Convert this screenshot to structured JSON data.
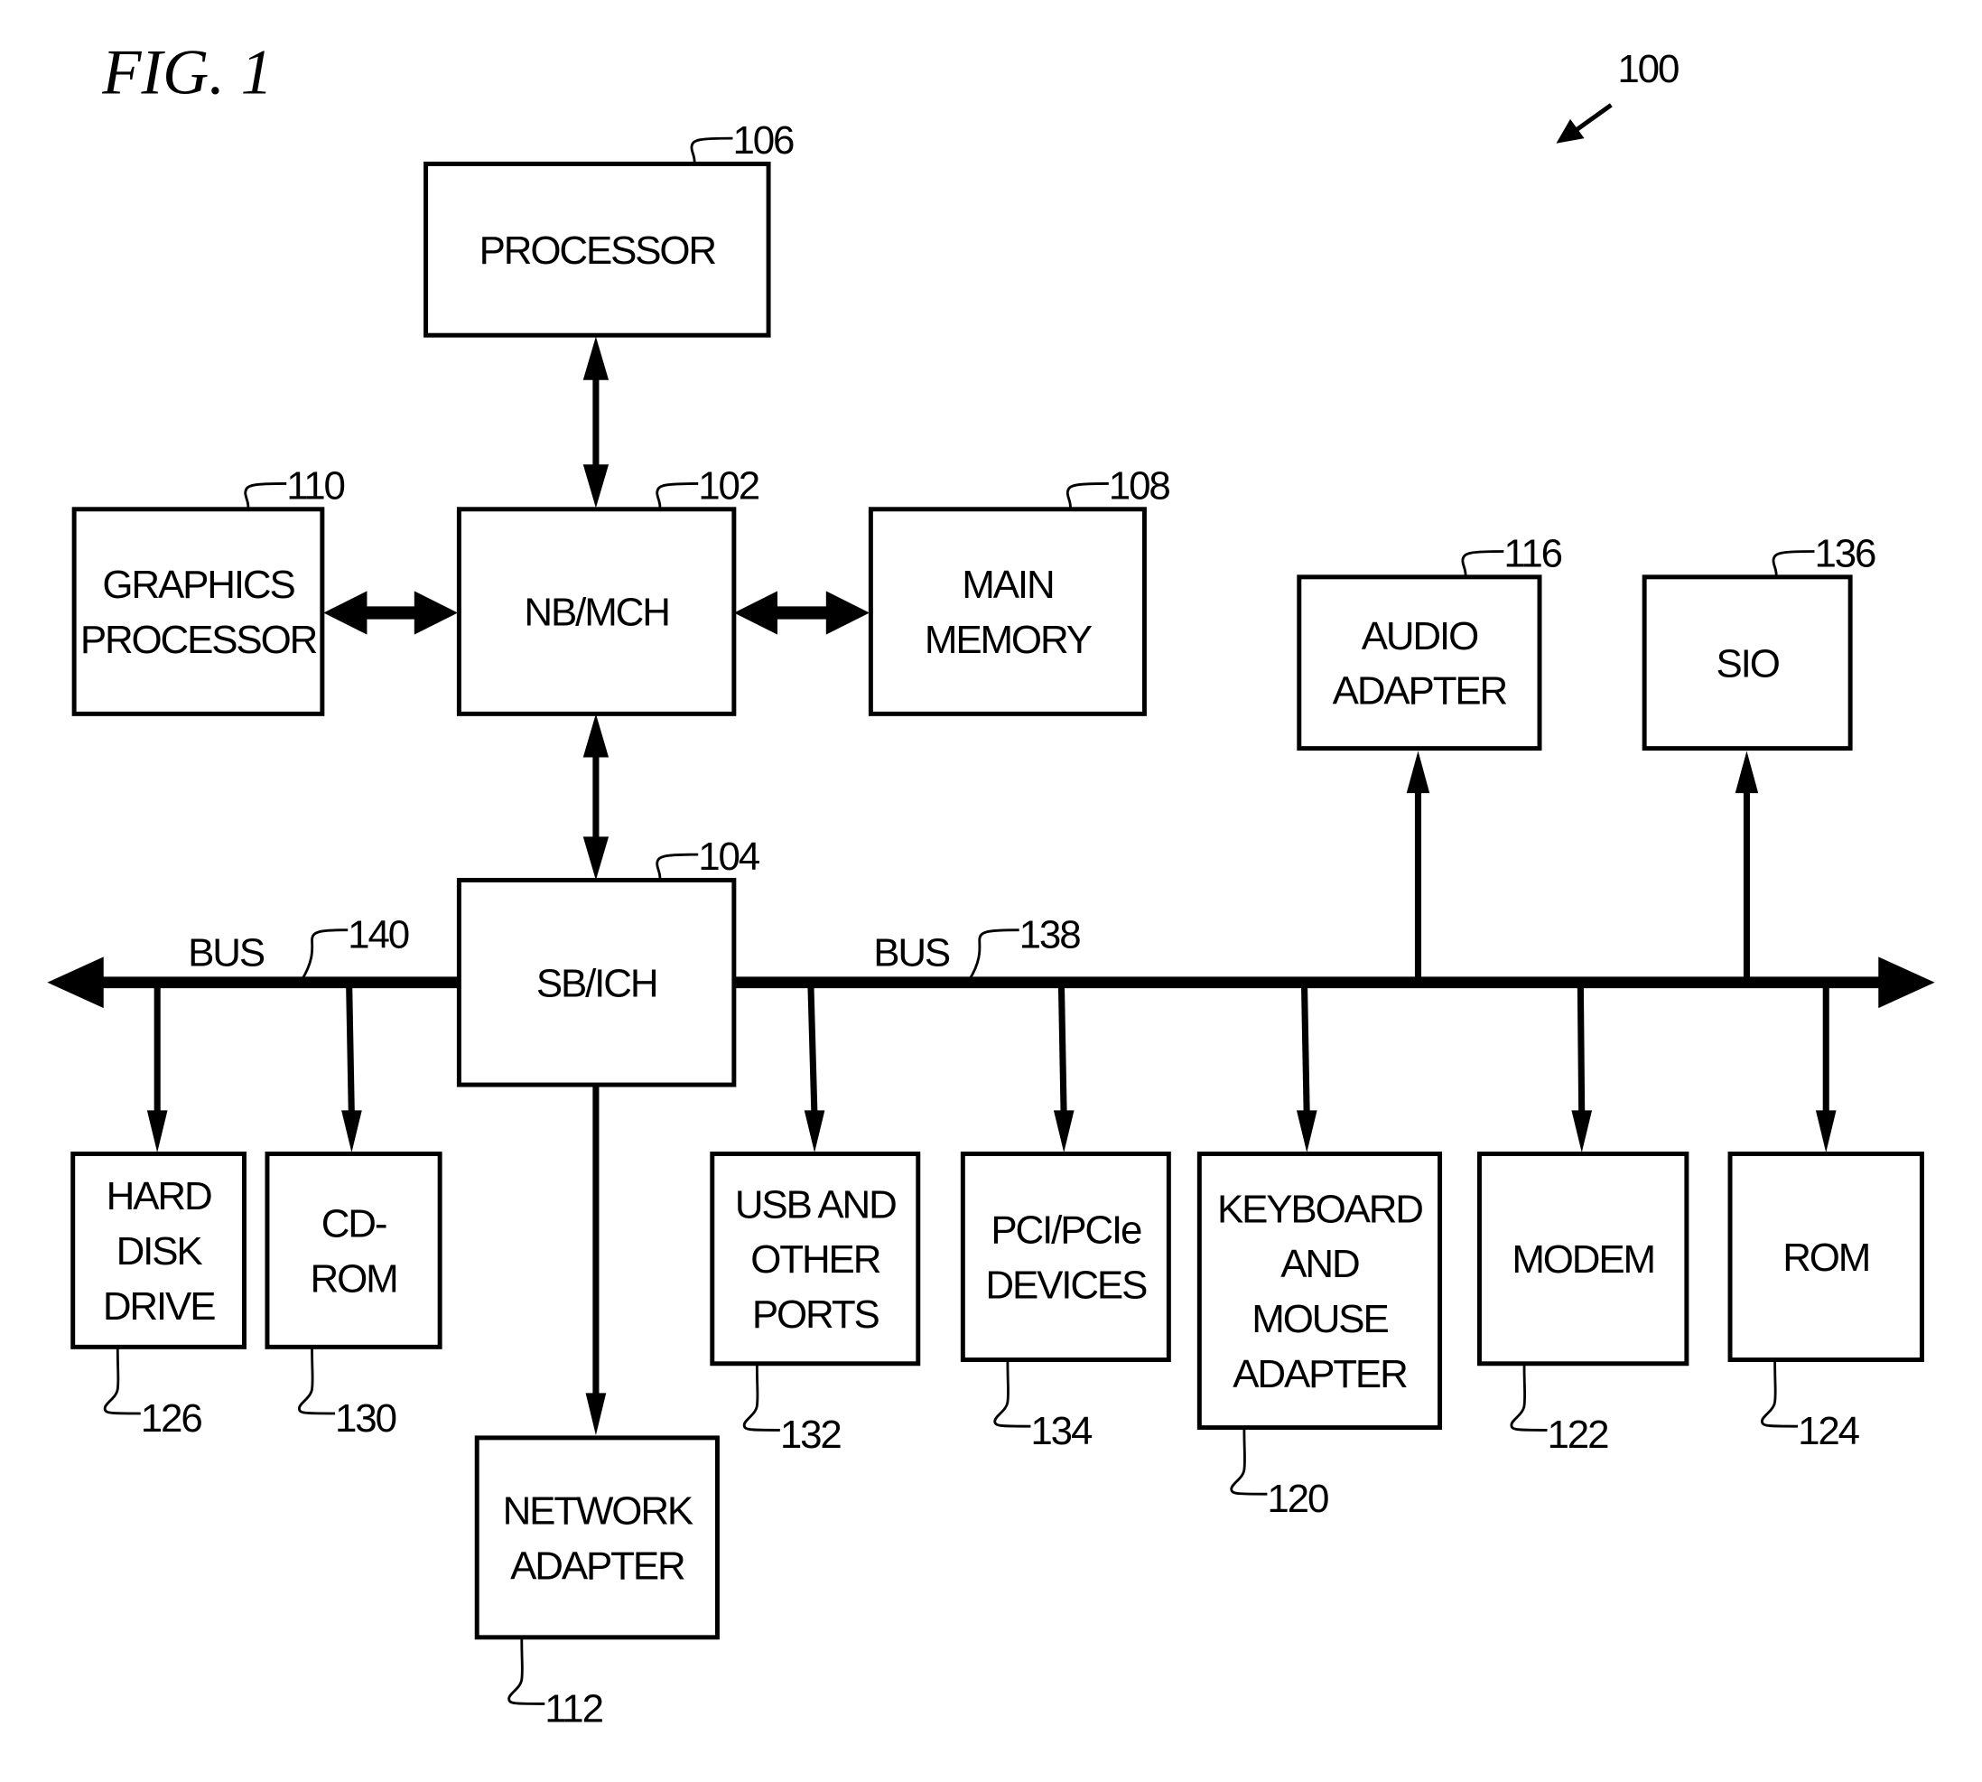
{
  "figure": {
    "title": "FIG. 1",
    "system_ref": "100"
  },
  "blocks": [
    {
      "id": "processor",
      "lines": [
        "PROCESSOR"
      ],
      "ref": "106"
    },
    {
      "id": "graphics",
      "lines": [
        "GRAPHICS",
        "PROCESSOR"
      ],
      "ref": "110"
    },
    {
      "id": "nbmch",
      "lines": [
        "NB/MCH"
      ],
      "ref": "102"
    },
    {
      "id": "mainmem",
      "lines": [
        "MAIN",
        "MEMORY"
      ],
      "ref": "108"
    },
    {
      "id": "audio",
      "lines": [
        "AUDIO",
        "ADAPTER"
      ],
      "ref": "116"
    },
    {
      "id": "sio",
      "lines": [
        "SIO"
      ],
      "ref": "136"
    },
    {
      "id": "sbich",
      "lines": [
        "SB/ICH"
      ],
      "ref": "104"
    },
    {
      "id": "hdd",
      "lines": [
        "HARD",
        "DISK",
        "DRIVE"
      ],
      "ref": "126"
    },
    {
      "id": "cdrom",
      "lines": [
        "CD-",
        "ROM"
      ],
      "ref": "130"
    },
    {
      "id": "network",
      "lines": [
        "NETWORK",
        "ADAPTER"
      ],
      "ref": "112"
    },
    {
      "id": "usb",
      "lines": [
        "USB AND",
        "OTHER",
        "PORTS"
      ],
      "ref": "132"
    },
    {
      "id": "pci",
      "lines": [
        "PCI/PCIe",
        "DEVICES"
      ],
      "ref": "134"
    },
    {
      "id": "kbd",
      "lines": [
        "KEYBOARD",
        "AND",
        "MOUSE",
        "ADAPTER"
      ],
      "ref": "120"
    },
    {
      "id": "modem",
      "lines": [
        "MODEM"
      ],
      "ref": "122"
    },
    {
      "id": "rom",
      "lines": [
        "ROM"
      ],
      "ref": "124"
    }
  ],
  "buses": [
    {
      "id": "bus-left",
      "label": "BUS",
      "ref": "140"
    },
    {
      "id": "bus-right",
      "label": "BUS",
      "ref": "138"
    }
  ]
}
